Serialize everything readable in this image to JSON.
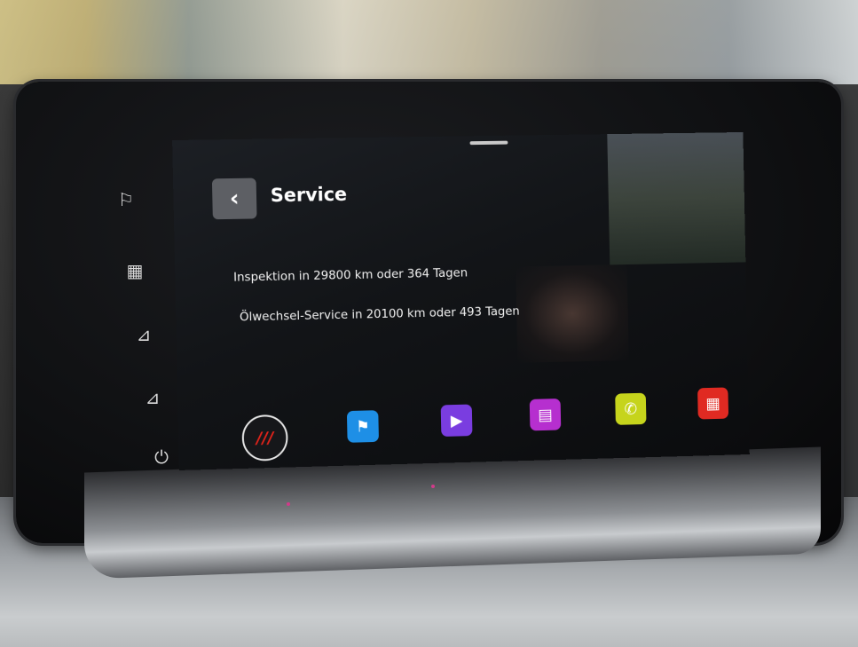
{
  "screen": {
    "title": "Service",
    "back_icon": "chevron-left-icon",
    "lines": [
      "Inspektion in 29800 km oder 364 Tagen",
      "Ölwechsel-Service in 20100 km oder 493 Tagen"
    ]
  },
  "dock": {
    "home_label": "///",
    "apps": [
      {
        "icon": "navigation-flag-icon",
        "color": "#1e8fe6",
        "glyph": "⚑"
      },
      {
        "icon": "media-play-icon",
        "color": "#7a3de0",
        "glyph": "▶"
      },
      {
        "icon": "radio-icon",
        "color": "#b62fcf",
        "glyph": "▤"
      },
      {
        "icon": "phone-icon",
        "color": "#c6d41c",
        "glyph": "✆"
      },
      {
        "icon": "car-settings-icon",
        "color": "#e02a22",
        "glyph": "▦"
      }
    ]
  },
  "side_buttons": [
    {
      "icon": "navigation-flag-icon",
      "glyph": "⚐"
    },
    {
      "icon": "car-menu-icon",
      "glyph": "▦"
    },
    {
      "icon": "volume-up-icon",
      "glyph": "⊿"
    },
    {
      "icon": "volume-down-icon",
      "glyph": "⊿"
    },
    {
      "icon": "power-icon",
      "glyph": "⏻"
    }
  ]
}
